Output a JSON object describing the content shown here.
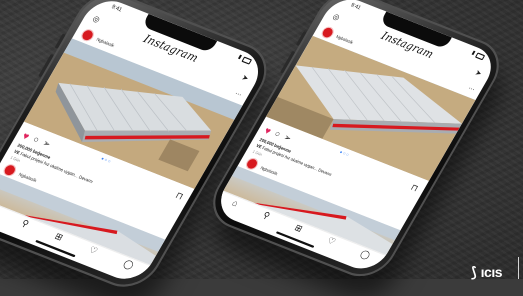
{
  "phones": [
    {
      "statusbar": {
        "time": "9:41"
      },
      "app": {
        "logo": "Instagram"
      },
      "post": {
        "account": "Ngbalaslk",
        "likes": "200,000 beğenme",
        "caption_user": "VE",
        "caption_text": "Fabul projesi hız okalme uygan... Devamı",
        "time": "1 Gün"
      },
      "icons": {
        "camera": "camera-icon",
        "send": "send-icon",
        "heart": "heart-icon",
        "comment": "comment-icon",
        "share": "share-icon",
        "bookmark": "bookmark-icon",
        "home": "home-icon",
        "search": "search-icon",
        "add": "add-icon",
        "activity": "activity-icon",
        "profile": "profile-icon"
      }
    },
    {
      "statusbar": {
        "time": "9:41"
      },
      "app": {
        "logo": "Instagram"
      },
      "post": {
        "account": "Ngbalaslk",
        "likes": "200,000 beğenme",
        "caption_user": "VE",
        "caption_text": "Fabul projesi hız okalme uygan... Devamı",
        "time": "1 Gün"
      }
    }
  ],
  "brand": {
    "text": "ıcıs"
  },
  "colors": {
    "accent": "#d7191f",
    "heart": "#e0245e",
    "background": "#3b3b3b"
  }
}
